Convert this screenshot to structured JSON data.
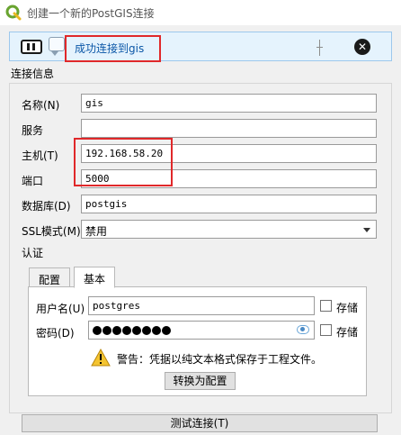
{
  "window": {
    "title": "创建一个新的PostGIS连接",
    "icon": "qgis-logo-icon"
  },
  "message_bar": {
    "text": "成功连接到gis",
    "highlight_color": "#e0282a",
    "background": "#e5f3fd"
  },
  "connection_info": {
    "section_title": "连接信息",
    "fields": {
      "name_label": "名称(N)",
      "name_value": "gis",
      "service_label": "服务",
      "service_value": "",
      "host_label": "主机(T)",
      "host_value": "192.168.58.20",
      "port_label": "端口",
      "port_value": "5000",
      "database_label": "数据库(D)",
      "database_value": "postgis",
      "ssl_label": "SSL模式(M)",
      "ssl_value": "禁用"
    }
  },
  "auth": {
    "section_title": "认证",
    "tabs": [
      {
        "label": "配置",
        "active": false
      },
      {
        "label": "基本",
        "active": true
      }
    ],
    "username_label": "用户名(U)",
    "username_value": "postgres",
    "username_store_label": "存储",
    "password_label": "密码(D)",
    "password_masked_length": 8,
    "password_store_label": "存储",
    "warning_text": "警告：凭据以纯文本格式保存于工程文件。",
    "convert_button": "转换为配置"
  },
  "actions": {
    "test_button": "测试连接(T)"
  }
}
